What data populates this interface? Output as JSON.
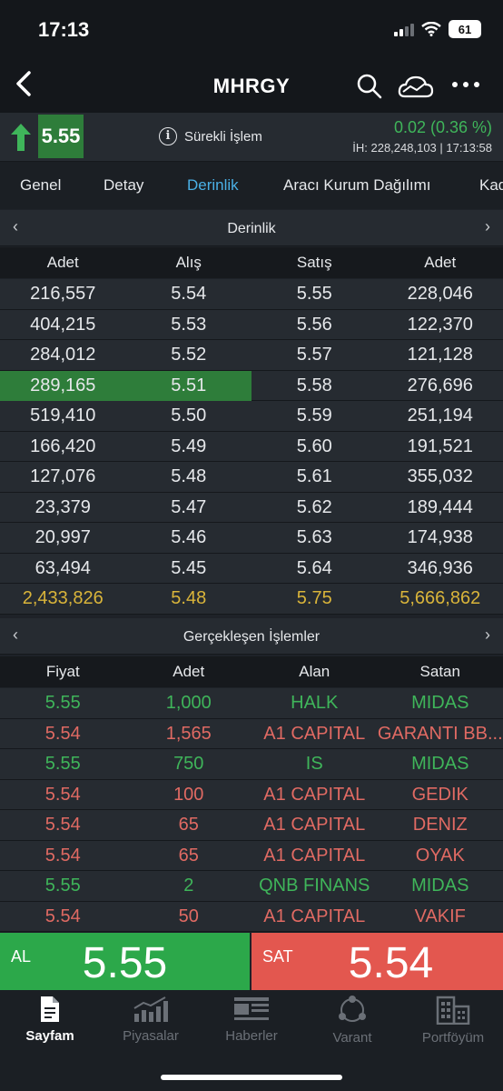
{
  "status": {
    "time": "17:13",
    "battery": "61"
  },
  "nav": {
    "title": "MHRGY"
  },
  "price": {
    "last": "5.55",
    "session": "Sürekli İşlem",
    "change": "0.02 (0.36 %)",
    "volume": "İH:  228,248,103 | 17:13:58"
  },
  "tabs": [
    "Genel",
    "Detay",
    "Derinlik",
    "Aracı Kurum Dağılımı",
    "Kad"
  ],
  "depth": {
    "title": "Derinlik",
    "columns": [
      "Adet",
      "Alış",
      "Satış",
      "Adet"
    ],
    "rows": [
      [
        "216,557",
        "5.54",
        "5.55",
        "228,046"
      ],
      [
        "404,215",
        "5.53",
        "5.56",
        "122,370"
      ],
      [
        "284,012",
        "5.52",
        "5.57",
        "121,128"
      ],
      [
        "289,165",
        "5.51",
        "5.58",
        "276,696"
      ],
      [
        "519,410",
        "5.50",
        "5.59",
        "251,194"
      ],
      [
        "166,420",
        "5.49",
        "5.60",
        "191,521"
      ],
      [
        "127,076",
        "5.48",
        "5.61",
        "355,032"
      ],
      [
        "23,379",
        "5.47",
        "5.62",
        "189,444"
      ],
      [
        "20,997",
        "5.46",
        "5.63",
        "174,938"
      ],
      [
        "63,494",
        "5.45",
        "5.64",
        "346,936"
      ]
    ],
    "total": [
      "2,433,826",
      "5.48",
      "5.75",
      "5,666,862"
    ]
  },
  "trades": {
    "title": "Gerçekleşen İşlemler",
    "columns": [
      "Fiyat",
      "Adet",
      "Alan",
      "Satan"
    ],
    "rows": [
      [
        "5.55",
        "1,000",
        "HALK",
        "MIDAS"
      ],
      [
        "5.54",
        "1,565",
        "A1 CAPITAL",
        "GARANTI BB..."
      ],
      [
        "5.55",
        "750",
        "IS",
        "MIDAS"
      ],
      [
        "5.54",
        "100",
        "A1 CAPITAL",
        "GEDIK"
      ],
      [
        "5.54",
        "65",
        "A1 CAPITAL",
        "DENIZ"
      ],
      [
        "5.54",
        "65",
        "A1 CAPITAL",
        "OYAK"
      ],
      [
        "5.55",
        "2",
        "QNB FINANS",
        "MIDAS"
      ],
      [
        "5.54",
        "50",
        "A1 CAPITAL",
        "VAKIF"
      ]
    ],
    "row_colors": [
      "up",
      "down",
      "up",
      "down",
      "down",
      "down",
      "up",
      "down"
    ]
  },
  "buy": {
    "label": "AL",
    "price": "5.55"
  },
  "sell": {
    "label": "SAT",
    "price": "5.54"
  },
  "tabbar": [
    "Sayfam",
    "Piyasalar",
    "Haberler",
    "Varant",
    "Portföyüm"
  ],
  "colors": {
    "up": "#3fb55a",
    "down": "#e06a63",
    "accent": "#4ab0e6",
    "total": "#d9b43a"
  }
}
